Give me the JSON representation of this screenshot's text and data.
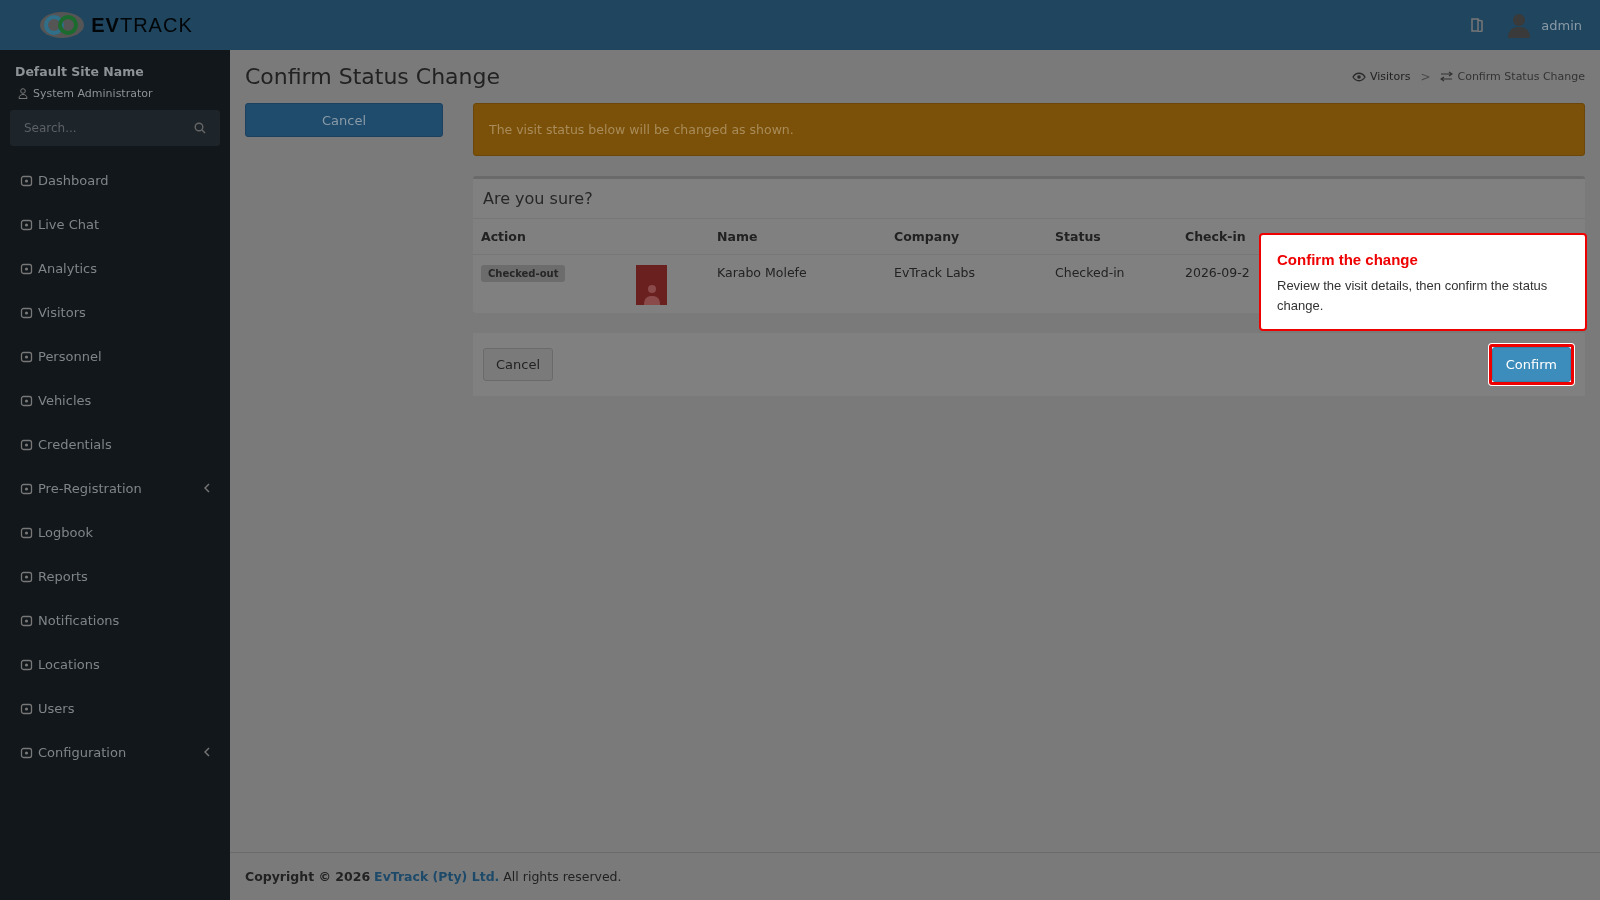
{
  "header": {
    "logo": "**EV**TRACK",
    "user": "admin"
  },
  "sidebar": {
    "site": "Default Site Name",
    "role": "System Administrator",
    "search": {
      "placeholder": "Search..."
    },
    "items": [
      {
        "label": "Dashboard",
        "has_submenu": false
      },
      {
        "label": "Live Chat",
        "has_submenu": false
      },
      {
        "label": "Analytics",
        "has_submenu": false
      },
      {
        "label": "Visitors",
        "has_submenu": false
      },
      {
        "label": "Personnel",
        "has_submenu": false
      },
      {
        "label": "Vehicles",
        "has_submenu": false
      },
      {
        "label": "Credentials",
        "has_submenu": false
      },
      {
        "label": "Pre-Registration",
        "has_submenu": true
      },
      {
        "label": "Logbook",
        "has_submenu": false
      },
      {
        "label": "Reports",
        "has_submenu": false
      },
      {
        "label": "Notifications",
        "has_submenu": false
      },
      {
        "label": "Locations",
        "has_submenu": false
      },
      {
        "label": "Users",
        "has_submenu": false
      },
      {
        "label": "Configuration",
        "has_submenu": true
      }
    ]
  },
  "page": {
    "title": "Confirm Status Change",
    "breadcrumb": [
      "Visitors",
      "Confirm Status Change"
    ],
    "breadcrumb_separator": ">",
    "side_button": "Cancel"
  },
  "alert": "The visit status below will be changed as shown.",
  "panel": {
    "title": "Are you sure?",
    "columns": [
      "Action",
      "Name",
      "Company",
      "Status",
      "Check-in"
    ],
    "rows": [
      {
        "action": "Checked-out",
        "name": "Karabo Molefe",
        "company": "EvTrack Labs",
        "status": "Checked-in",
        "check_in": "2026-09-2"
      }
    ],
    "cancel": "Cancel",
    "confirm": "Confirm"
  },
  "tooltip": {
    "title": "Confirm the change",
    "text": "Review the visit details, then confirm the status change."
  },
  "footer": {
    "prefix": "Copyright © 2026",
    "link": "EvTrack (Pty) Ltd.",
    "suffix": "All rights reserved."
  }
}
